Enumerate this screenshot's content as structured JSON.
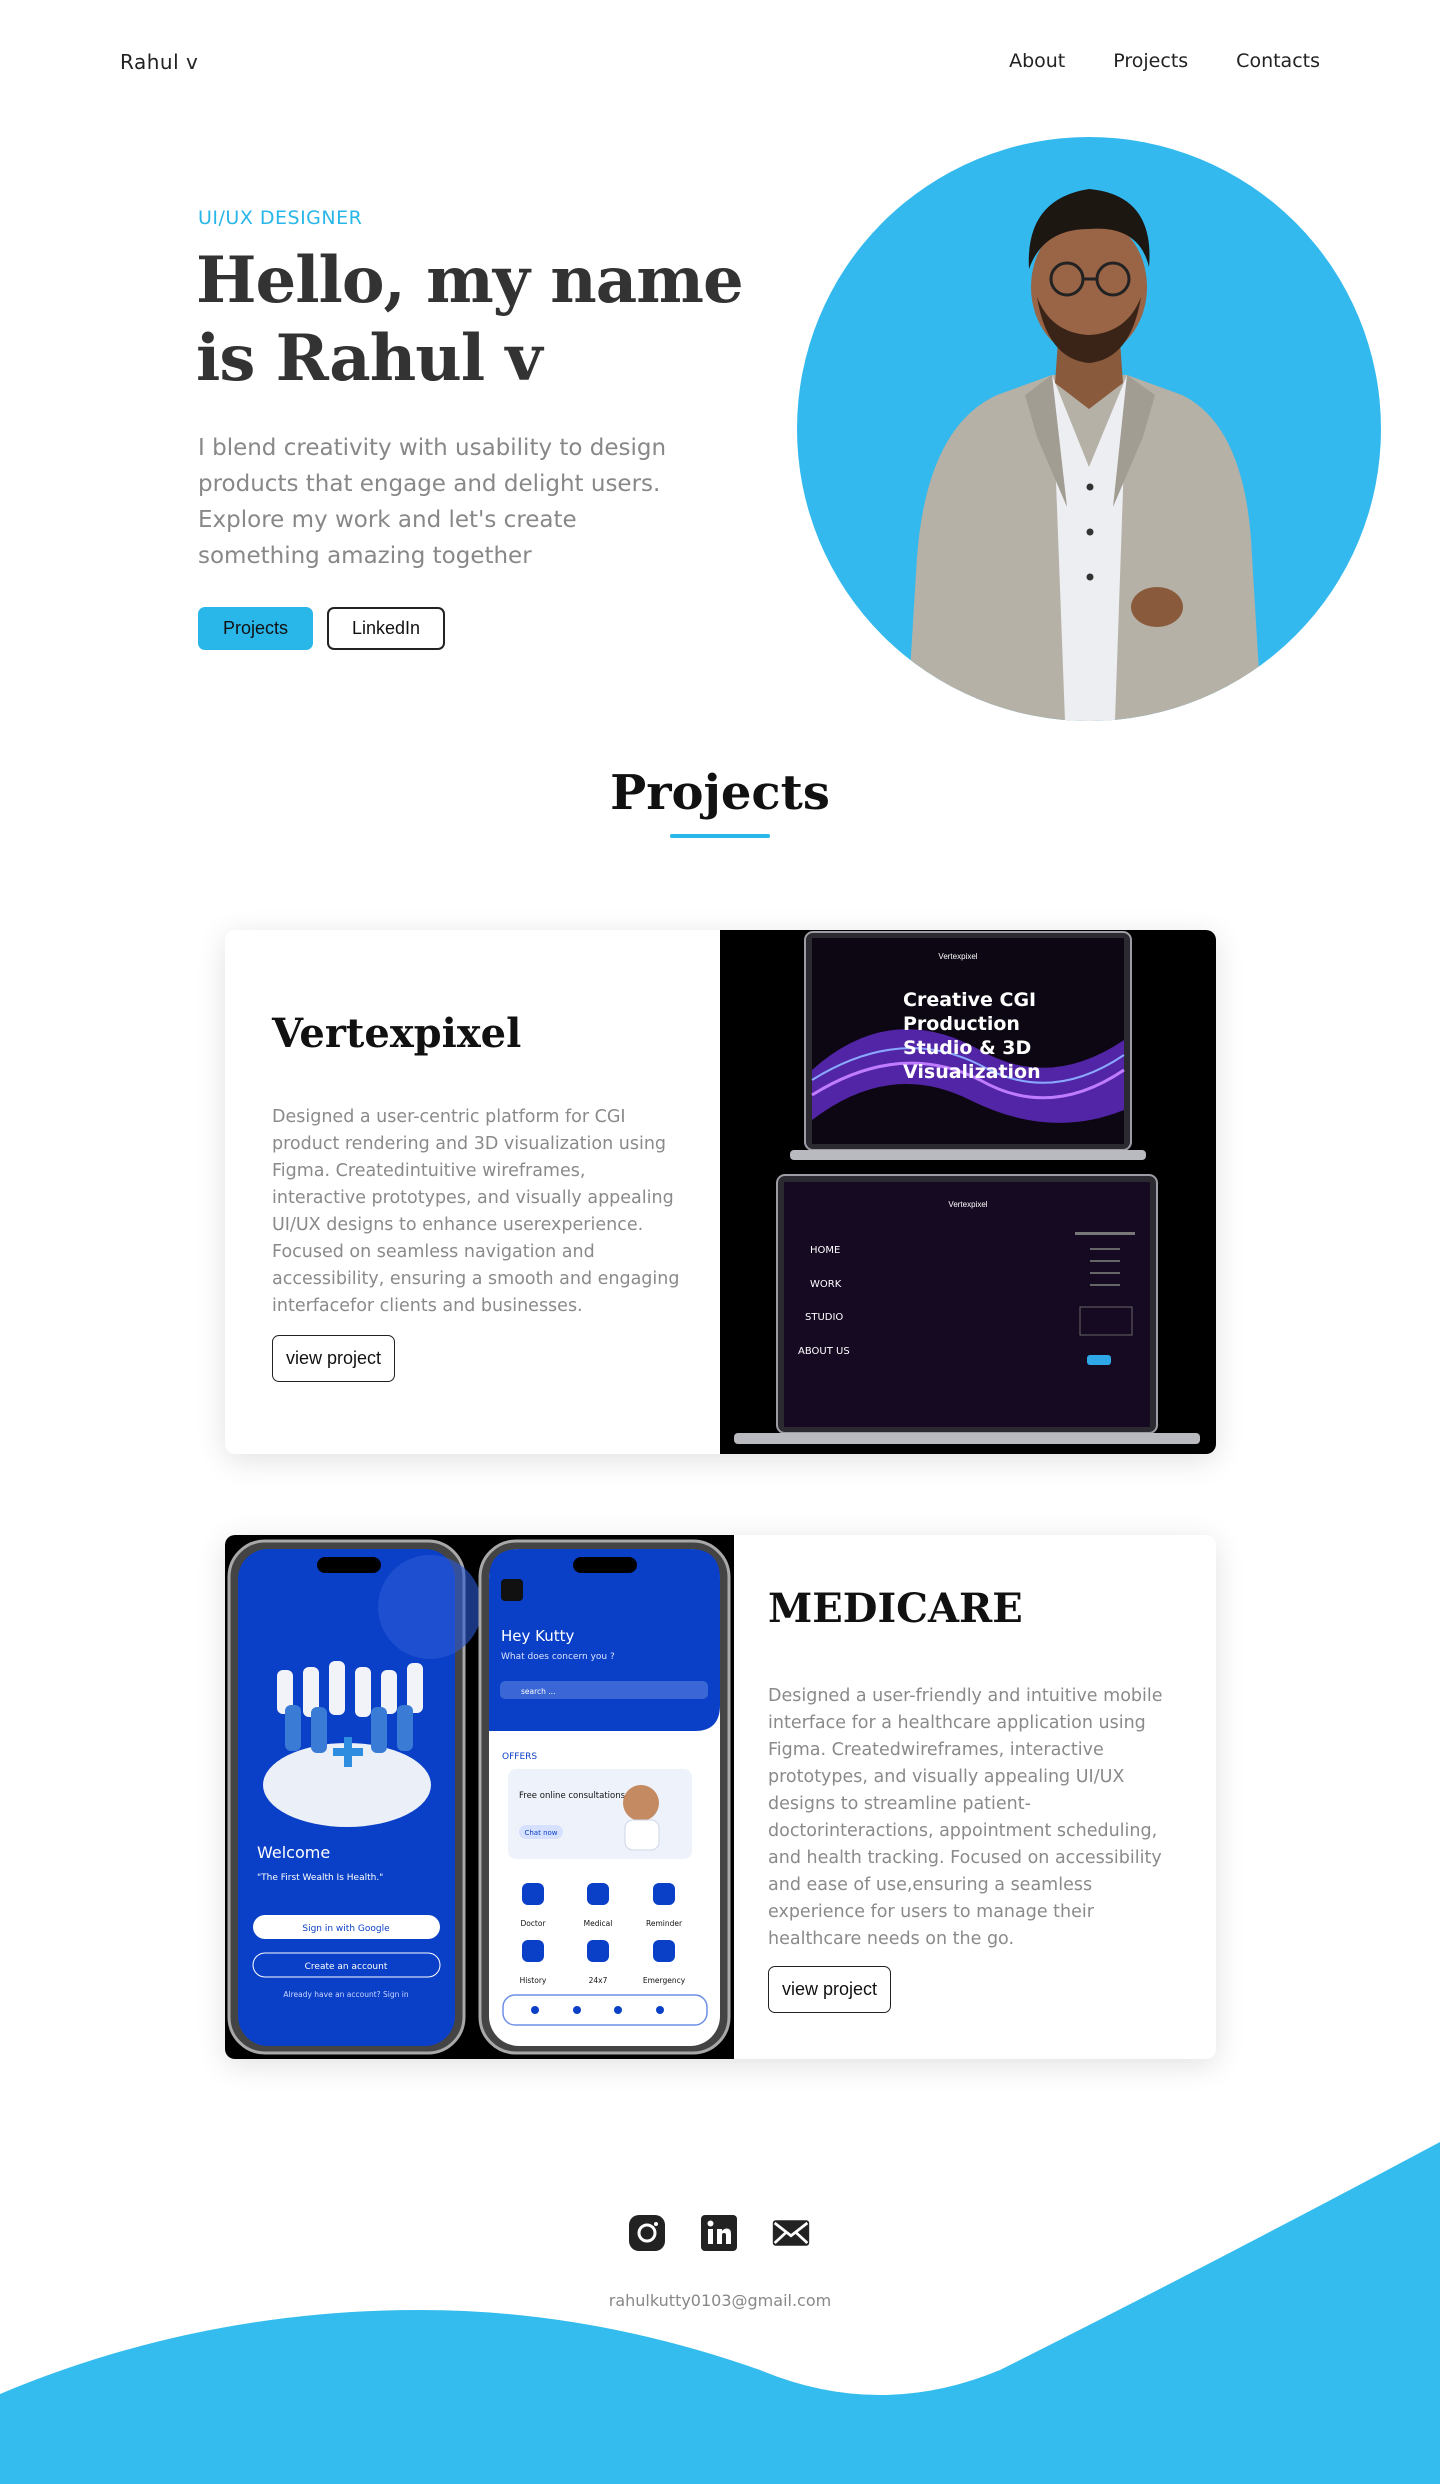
{
  "nav": {
    "brand": "Rahul  v",
    "links": [
      "About",
      "Projects",
      "Contacts"
    ]
  },
  "hero": {
    "role": "UI/UX DESIGNER",
    "title_line1": "Hello,  my name",
    "title_line2": "is Rahul v",
    "description": "I blend creativity with usability to design products that engage and delight users. Explore my work and let's create something amazing together",
    "btn_projects": "Projects",
    "btn_linkedin": "LinkedIn"
  },
  "projects_section": {
    "title": "Projects"
  },
  "projects": [
    {
      "title": "Vertexpixel",
      "description": "Designed a user-centric platform for CGI product rendering and 3D visualization using Figma. Createdintuitive wireframes, interactive prototypes, and visually appealing UI/UX designs to enhance userexperience. Focused on seamless navigation and accessibility, ensuring a smooth and engaging interfacefor clients and businesses.",
      "button": "view project",
      "screen": {
        "brand": "Vertexpixel",
        "headline_1": "Creative CGI",
        "headline_2": "Production",
        "headline_3": "Studio & 3D",
        "headline_4": "Visualization",
        "menu": [
          "HOME",
          "WORK",
          "STUDIO",
          "ABOUT US"
        ]
      }
    },
    {
      "title": "MEDICARE",
      "description": "Designed a user-friendly and intuitive mobile interface for a healthcare application using Figma. Createdwireframes, interactive prototypes, and visually appealing UI/UX designs to streamline patient-doctorinteractions, appointment scheduling, and health tracking. Focused on accessibility and ease of use,ensuring a seamless experience for users to manage their healthcare needs on the go.",
      "button": "view project",
      "screen_left": {
        "welcome": "Welcome",
        "quote": "\"The First Wealth Is Health.\"",
        "google": "Sign in with Google",
        "create": "Create an account",
        "already": "Already have an  account? Sign in"
      },
      "screen_right": {
        "greeting": "Hey Kutty",
        "question": "What does concern you ?",
        "search": "search ...",
        "offers": "OFFERS",
        "offer_text": "Free online consultations",
        "chat": "Chat now",
        "services": [
          "Doctor",
          "Medical",
          "Reminder",
          "History",
          "24x7",
          "Emergency"
        ]
      }
    }
  ],
  "footer": {
    "email": "rahulkutty0103@gmail.com",
    "icons": [
      "instagram-icon",
      "linkedin-icon",
      "mail-icon"
    ]
  },
  "colors": {
    "accent": "#29b6e8",
    "dark": "#333333",
    "muted": "#888888"
  }
}
